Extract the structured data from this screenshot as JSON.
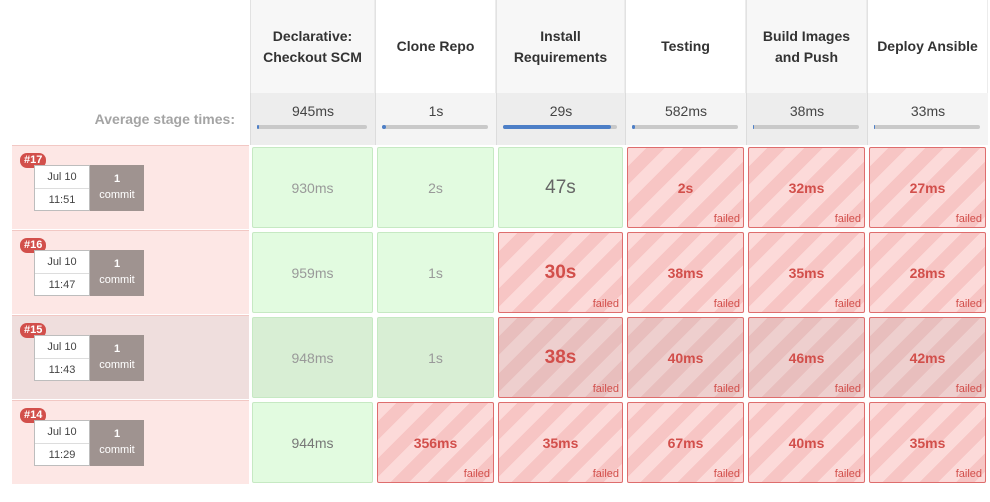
{
  "stages": [
    {
      "name": "Declarative: Checkout SCM",
      "avg": "945ms",
      "avg_progress": 0.02
    },
    {
      "name": "Clone Repo",
      "avg": "1s",
      "avg_progress": 0.04
    },
    {
      "name": "Install Requirements",
      "avg": "29s",
      "avg_progress": 0.95
    },
    {
      "name": "Testing",
      "avg": "582ms",
      "avg_progress": 0.03
    },
    {
      "name": "Build Images and Push",
      "avg": "38ms",
      "avg_progress": 0.0
    },
    {
      "name": "Deploy Ansible",
      "avg": "33ms",
      "avg_progress": 0.0
    }
  ],
  "average_label": "Average stage times:",
  "commit_word": "commit",
  "failed_label": "failed",
  "builds": [
    {
      "id": "#17",
      "date": "Jul 10",
      "time": "11:51",
      "commits": "1",
      "cells": [
        {
          "value": "930ms",
          "status": "success"
        },
        {
          "value": "2s",
          "status": "success"
        },
        {
          "value": "47s",
          "status": "success"
        },
        {
          "value": "2s",
          "status": "failed"
        },
        {
          "value": "32ms",
          "status": "failed"
        },
        {
          "value": "27ms",
          "status": "failed"
        }
      ]
    },
    {
      "id": "#16",
      "date": "Jul 10",
      "time": "11:47",
      "commits": "1",
      "cells": [
        {
          "value": "959ms",
          "status": "success"
        },
        {
          "value": "1s",
          "status": "success"
        },
        {
          "value": "30s",
          "status": "failed"
        },
        {
          "value": "38ms",
          "status": "failed"
        },
        {
          "value": "35ms",
          "status": "failed"
        },
        {
          "value": "28ms",
          "status": "failed"
        }
      ]
    },
    {
      "id": "#15",
      "date": "Jul 10",
      "time": "11:43",
      "commits": "1",
      "cells": [
        {
          "value": "948ms",
          "status": "success"
        },
        {
          "value": "1s",
          "status": "success"
        },
        {
          "value": "38s",
          "status": "failed"
        },
        {
          "value": "40ms",
          "status": "failed"
        },
        {
          "value": "46ms",
          "status": "failed"
        },
        {
          "value": "42ms",
          "status": "failed"
        }
      ]
    },
    {
      "id": "#14",
      "date": "Jul 10",
      "time": "11:29",
      "commits": "1",
      "cells": [
        {
          "value": "944ms",
          "status": "success"
        },
        {
          "value": "356ms",
          "status": "failed"
        },
        {
          "value": "35ms",
          "status": "failed"
        },
        {
          "value": "67ms",
          "status": "failed"
        },
        {
          "value": "40ms",
          "status": "failed"
        },
        {
          "value": "35ms",
          "status": "failed"
        }
      ]
    }
  ],
  "colors": {
    "success_bg": "#e2fbe0",
    "failed_bg": "#fbd3d2",
    "failed_text": "#d24f4b",
    "badge_bg": "#d24f4b",
    "progress": "#4d7fc7"
  }
}
